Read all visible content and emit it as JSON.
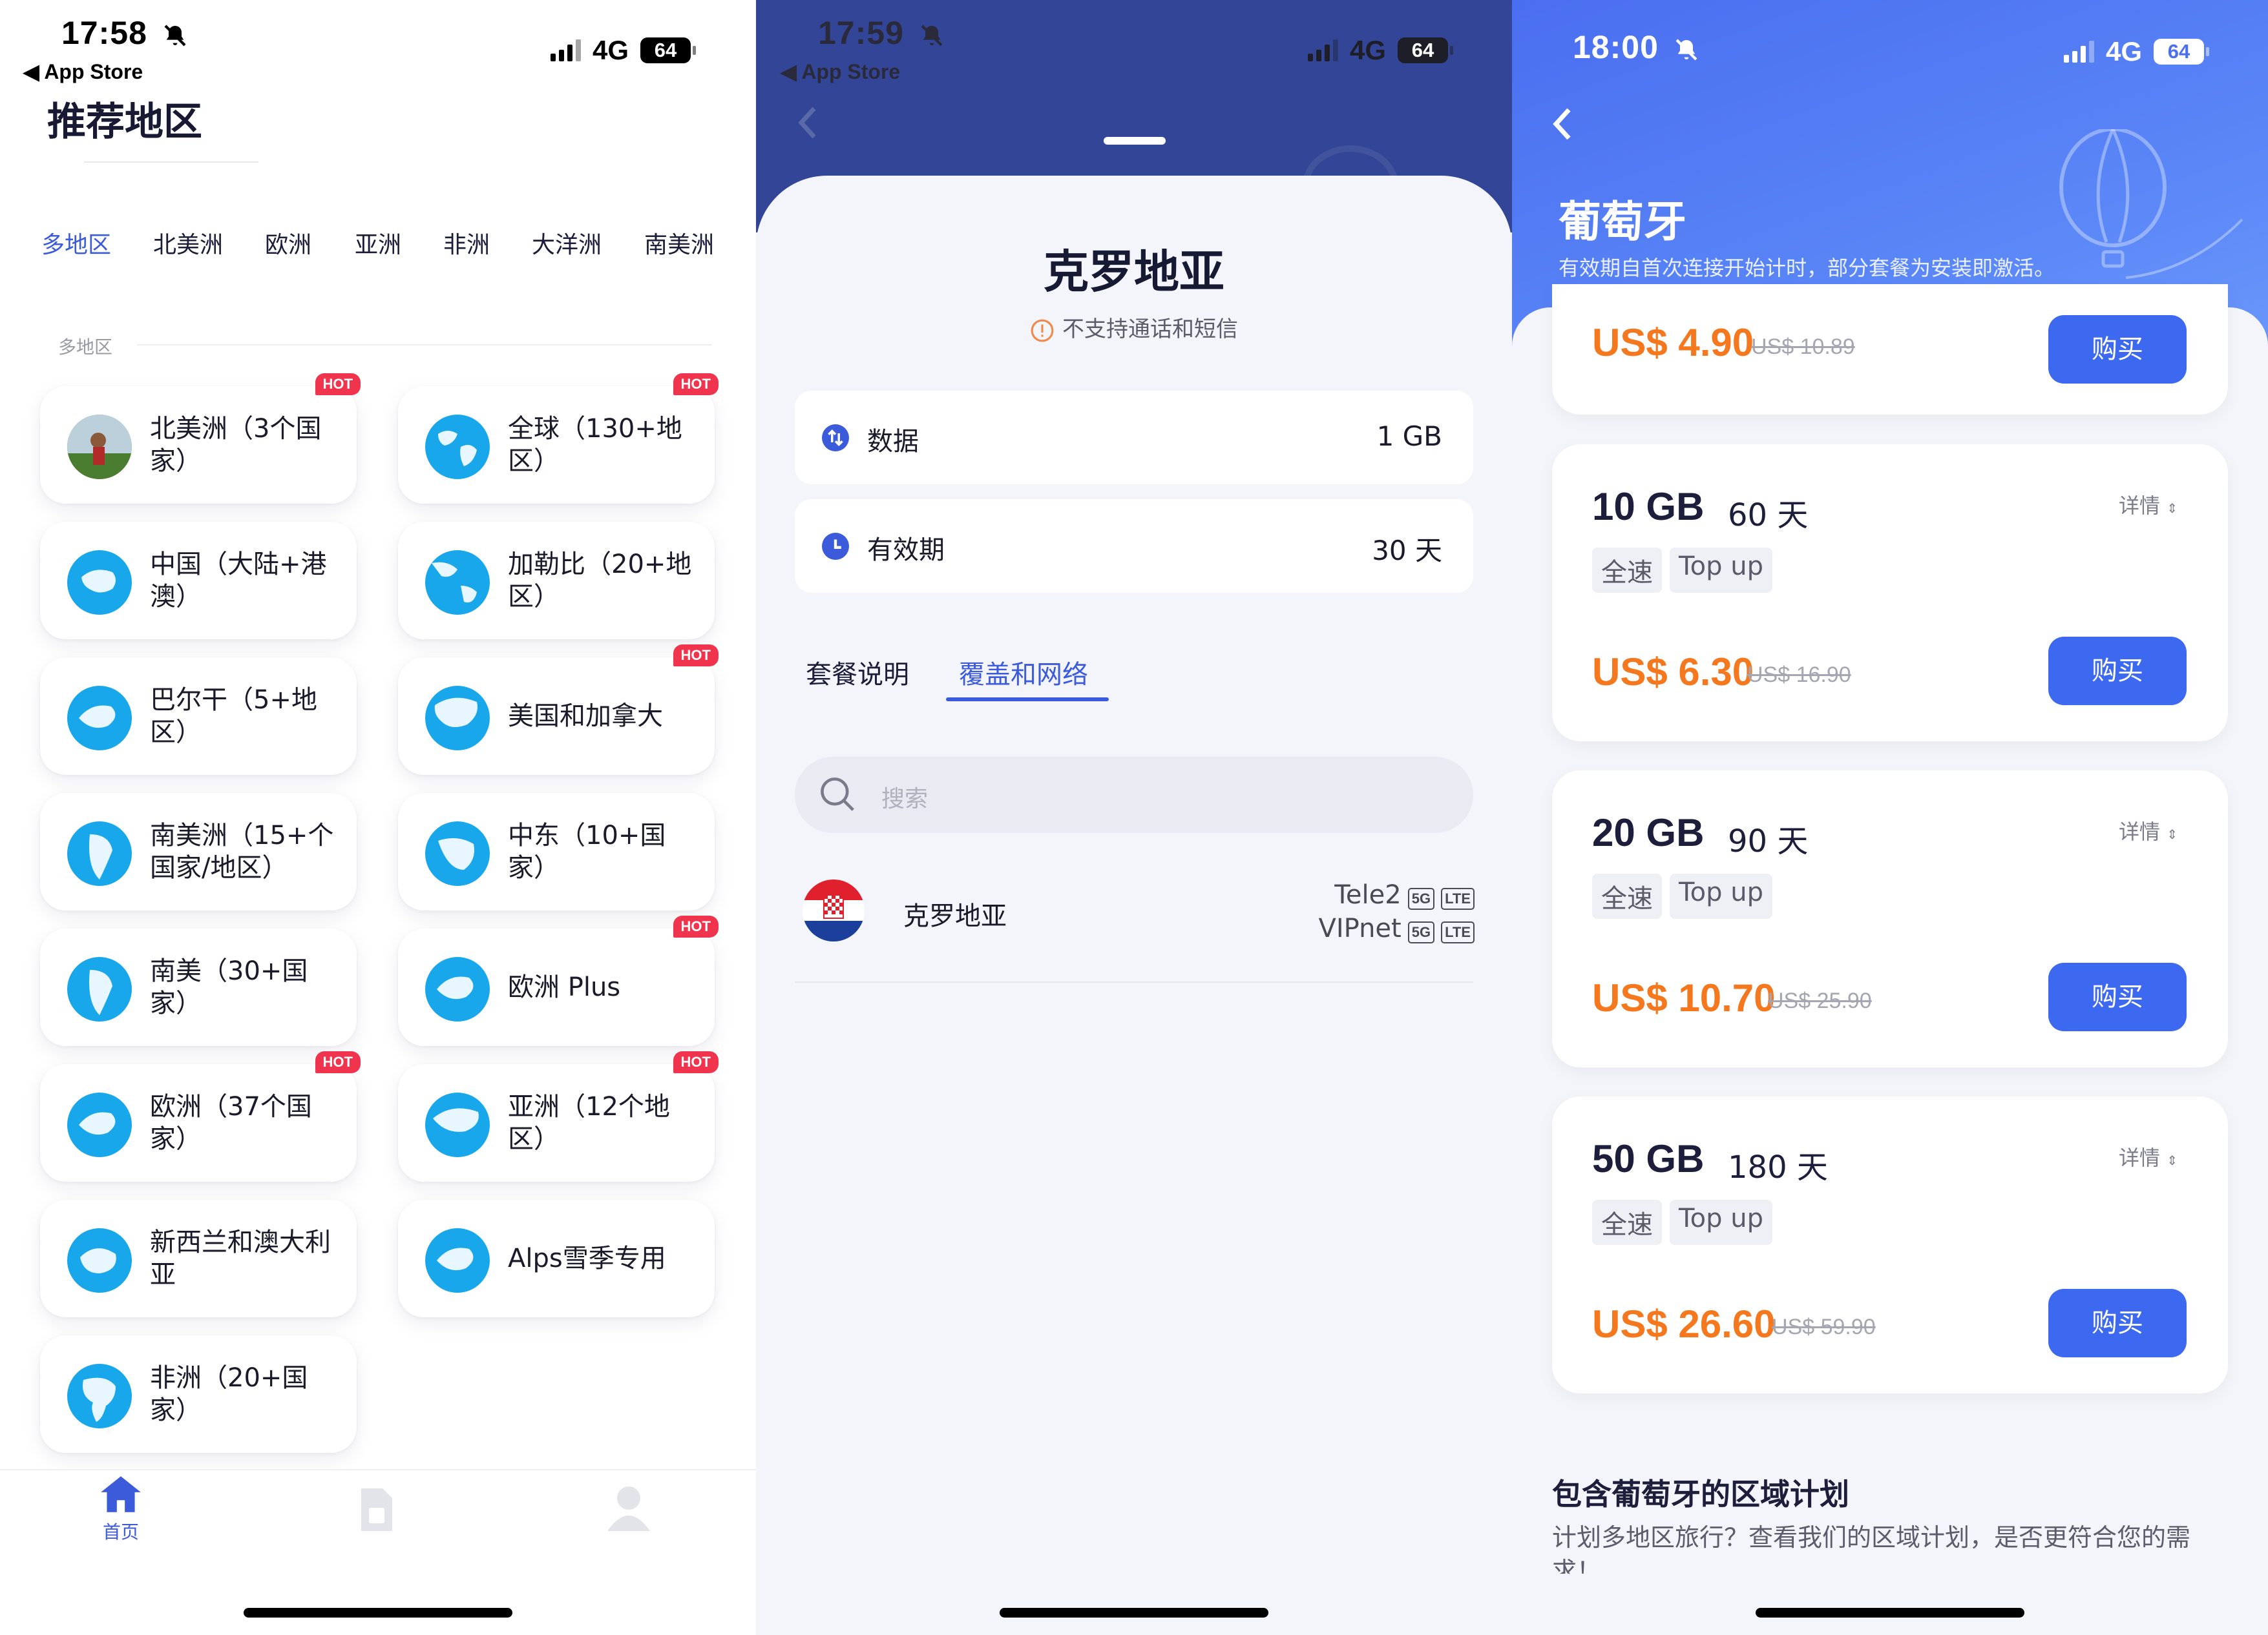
{
  "screen1": {
    "status": {
      "time": "17:58",
      "back_app": "App Store",
      "network": "4G",
      "battery": "64"
    },
    "title": "推荐地区",
    "region_tabs": [
      {
        "label": "多地区",
        "active": true
      },
      {
        "label": "北美洲"
      },
      {
        "label": "欧洲"
      },
      {
        "label": "亚洲"
      },
      {
        "label": "非洲"
      },
      {
        "label": "大洋洲"
      },
      {
        "label": "南美洲"
      }
    ],
    "section_header": "多地区",
    "hot_label": "HOT",
    "cards": [
      {
        "label": "北美洲（3个国家）",
        "hot": true
      },
      {
        "label": "全球（130+地区）",
        "hot": true
      },
      {
        "label": "中国（大陆+港澳）",
        "hot": false
      },
      {
        "label": "加勒比（20+地区）",
        "hot": false
      },
      {
        "label": "巴尔干（5+地区）",
        "hot": false
      },
      {
        "label": "美国和加拿大",
        "hot": true
      },
      {
        "label": "南美洲（15+个国家/地区）",
        "hot": false
      },
      {
        "label": "中东（10+国家）",
        "hot": false
      },
      {
        "label": "南美（30+国家）",
        "hot": false
      },
      {
        "label": "欧洲 Plus",
        "hot": true
      },
      {
        "label": "欧洲（37个国家）",
        "hot": true
      },
      {
        "label": "亚洲（12个地区）",
        "hot": true
      },
      {
        "label": "新西兰和澳大利亚",
        "hot": false
      },
      {
        "label": "Alps雪季专用",
        "hot": false
      },
      {
        "label": "非洲（20+国家）",
        "hot": false
      }
    ],
    "tabbar": {
      "home_label": "首页"
    }
  },
  "screen2": {
    "status": {
      "time": "17:59",
      "back_app": "App Store",
      "network": "4G",
      "battery": "64"
    },
    "title": "克罗地亚",
    "warning": "不支持通话和短信",
    "data_row": {
      "label": "数据",
      "value": "1 GB"
    },
    "validity_row": {
      "label": "有效期",
      "value": "30 天"
    },
    "tabs": [
      {
        "label": "套餐说明"
      },
      {
        "label": "覆盖和网络",
        "active": true
      }
    ],
    "search_placeholder": "搜索",
    "network": {
      "country": "克罗地亚",
      "carriers": [
        {
          "name": "Tele2",
          "badges": [
            "5G",
            "LTE"
          ]
        },
        {
          "name": "VIPnet",
          "badges": [
            "5G",
            "LTE"
          ]
        }
      ]
    },
    "colors": {
      "header": "#324596",
      "accent": "#3b5bdb"
    }
  },
  "screen3": {
    "status": {
      "time": "18:00",
      "network": "4G",
      "battery": "64"
    },
    "title": "葡萄牙",
    "subtitle": "有效期自首次连接开始计时，部分套餐为安装即激活。",
    "top_plan": {
      "price": "US$ 4.90",
      "old_price": "US$ 10.89",
      "buy": "购买"
    },
    "plans": [
      {
        "data": "10 GB",
        "days": "60 天",
        "detail": "详情",
        "tags": [
          "全速",
          "Top up"
        ],
        "price": "US$ 6.30",
        "old_price": "US$ 16.90",
        "buy": "购买"
      },
      {
        "data": "20 GB",
        "days": "90 天",
        "detail": "详情",
        "tags": [
          "全速",
          "Top up"
        ],
        "price": "US$ 10.70",
        "old_price": "US$ 25.90",
        "buy": "购买"
      },
      {
        "data": "50 GB",
        "days": "180 天",
        "detail": "详情",
        "tags": [
          "全速",
          "Top up"
        ],
        "price": "US$ 26.60",
        "old_price": "US$ 59.90",
        "buy": "购买"
      }
    ],
    "region_title": "包含葡萄牙的区域计划",
    "region_desc": "计划多地区旅行？查看我们的区域计划，是否更符合您的需求！",
    "colors": {
      "price": "#f5781f",
      "button": "#3d68f0"
    }
  }
}
